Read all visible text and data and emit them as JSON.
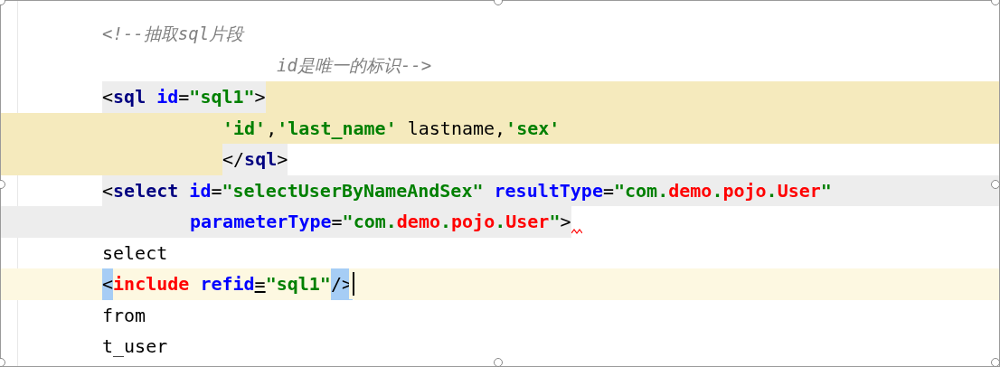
{
  "editor": {
    "lines": [
      {
        "kind": "plain",
        "tokens": [
          {
            "kind": "comment",
            "text": "<!--抽取sql片段"
          }
        ]
      },
      {
        "kind": "comment-cont",
        "tokens": [
          {
            "kind": "comment",
            "text": "id是唯一的标识-->"
          }
        ]
      },
      {
        "kind": "sql-open",
        "tokens": [
          {
            "kind": "punct",
            "text": "<"
          },
          {
            "kind": "tag",
            "text": "sql "
          },
          {
            "kind": "attr",
            "text": "id"
          },
          {
            "kind": "punct",
            "text": "="
          },
          {
            "kind": "str",
            "text": "\"sql1\""
          },
          {
            "kind": "punct",
            "text": ">"
          }
        ]
      },
      {
        "kind": "sql-body",
        "tokens": [
          {
            "kind": "str",
            "text": "'id'"
          },
          {
            "kind": "punct",
            "text": ","
          },
          {
            "kind": "str",
            "text": "'last_name'"
          },
          {
            "kind": "plain",
            "text": " lastname,"
          },
          {
            "kind": "str",
            "text": "'sex'"
          }
        ]
      },
      {
        "kind": "sql-close",
        "tokens": [
          {
            "kind": "punct",
            "text": "</"
          },
          {
            "kind": "tag",
            "text": "sql"
          },
          {
            "kind": "punct",
            "text": ">"
          }
        ]
      },
      {
        "kind": "select-open",
        "tokens": [
          {
            "kind": "punct",
            "text": "<"
          },
          {
            "kind": "tag",
            "text": "select "
          },
          {
            "kind": "attr",
            "text": "id"
          },
          {
            "kind": "punct",
            "text": "="
          },
          {
            "kind": "str",
            "text": "\"selectUserByNameAndSex\" "
          },
          {
            "kind": "attr",
            "text": "resultType"
          },
          {
            "kind": "punct",
            "text": "="
          },
          {
            "kind": "str",
            "text": "\"com."
          },
          {
            "kind": "str-red",
            "text": "demo"
          },
          {
            "kind": "str",
            "text": "."
          },
          {
            "kind": "str-red",
            "text": "pojo"
          },
          {
            "kind": "str",
            "text": "."
          },
          {
            "kind": "str-red",
            "text": "User"
          },
          {
            "kind": "str",
            "text": "\""
          }
        ]
      },
      {
        "kind": "select-cont",
        "warning": true,
        "tokens": [
          {
            "kind": "attr",
            "text": "parameterType"
          },
          {
            "kind": "punct",
            "text": "="
          },
          {
            "kind": "str",
            "text": "\"com."
          },
          {
            "kind": "str-red",
            "text": "demo"
          },
          {
            "kind": "str",
            "text": "."
          },
          {
            "kind": "str-red",
            "text": "pojo"
          },
          {
            "kind": "str",
            "text": "."
          },
          {
            "kind": "str-red",
            "text": "User"
          },
          {
            "kind": "str",
            "text": "\""
          },
          {
            "kind": "punct",
            "text": ">"
          }
        ]
      },
      {
        "kind": "plain",
        "tokens": [
          {
            "kind": "plain",
            "text": "select"
          }
        ]
      },
      {
        "kind": "current",
        "caret": true,
        "tokens": [
          {
            "kind": "sel",
            "text": "<"
          },
          {
            "kind": "tag-red",
            "text": "include "
          },
          {
            "kind": "attr",
            "text": "refid"
          },
          {
            "kind": "eq-mark",
            "text": "="
          },
          {
            "kind": "str",
            "text": "\"sql1\""
          },
          {
            "kind": "sel",
            "text": "/>"
          }
        ]
      },
      {
        "kind": "plain",
        "tokens": [
          {
            "kind": "plain",
            "text": "from"
          }
        ]
      },
      {
        "kind": "plain",
        "tokens": [
          {
            "kind": "plain",
            "text": "t_user"
          }
        ]
      }
    ]
  }
}
